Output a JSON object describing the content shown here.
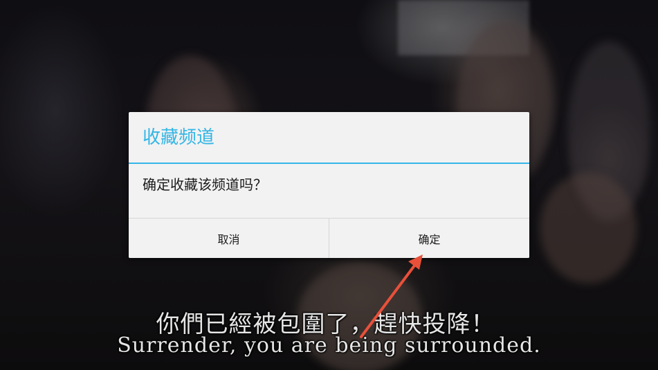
{
  "background_video": {
    "subtitle_zh": "你們已經被包圍了，趕快投降！",
    "subtitle_en": "Surrender, you are being surrounded."
  },
  "dialog": {
    "title": "收藏频道",
    "message": "确定收藏该频道吗？",
    "cancel_label": "取消",
    "confirm_label": "确定"
  },
  "colors": {
    "accent": "#33b5e5",
    "dialog_background": "#f2f2f2",
    "annotation_arrow": "#e8503a"
  }
}
